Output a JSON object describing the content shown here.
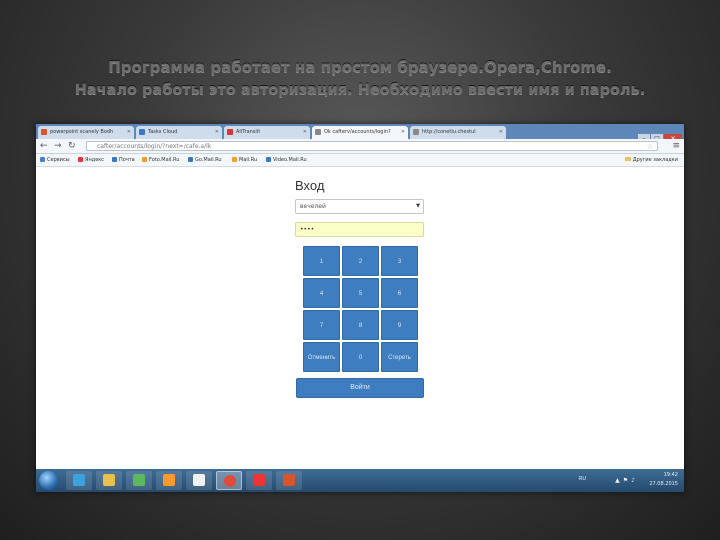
{
  "slide": {
    "title_line1": "Программа работает на простом браузере.Opera,Chrome.",
    "title_line2": "Начало работы это авторизация. Необходимо ввести имя и пароль."
  },
  "browser": {
    "tabs": [
      {
        "label": "powerpoint scanely Bodh",
        "color": "#d9532c"
      },
      {
        "label": "Tasks Cloud",
        "color": "#3b78c3"
      },
      {
        "label": "AllTranslit",
        "color": "#d33"
      },
      {
        "label": "Ok cafterv/accounts/login?",
        "color": "#888"
      },
      {
        "label": "http://conetlu.chestul",
        "color": "#888"
      }
    ],
    "window_buttons": {
      "min": "–",
      "max": "□",
      "close": "✕"
    },
    "url": "cafter/accounts/login/?next=/cafe.a/lk",
    "bookmarks": [
      {
        "label": "Сервисы",
        "color": "#4a7fd0"
      },
      {
        "label": "Яндекс",
        "color": "#e33"
      },
      {
        "label": "Почта",
        "color": "#3b78c3"
      },
      {
        "label": "Foto.Mail.Ru",
        "color": "#f0a030"
      },
      {
        "label": "Go.Mail.Ru",
        "color": "#3b78c3"
      },
      {
        "label": "Mail.Ru",
        "color": "#f0a030"
      },
      {
        "label": "Video.Mail.Ru",
        "color": "#3b78c3"
      }
    ],
    "other_bookmarks": "Другие закладки"
  },
  "login": {
    "title": "Вход",
    "user_selected": "вечелей",
    "password_value": "••••",
    "keys": [
      "1",
      "2",
      "3",
      "4",
      "5",
      "6",
      "7",
      "8",
      "9",
      "Отменить",
      "0",
      "Стереть"
    ],
    "submit_label": "Войти"
  },
  "taskbar": {
    "apps": [
      {
        "name": "ie",
        "color": "#3fa0e0"
      },
      {
        "name": "explorer",
        "color": "#e8c04a"
      },
      {
        "name": "app-green",
        "color": "#5cb85c"
      },
      {
        "name": "media",
        "color": "#ff9a2e"
      },
      {
        "name": "arrow",
        "color": "#f1f1f1"
      },
      {
        "name": "chrome",
        "color": "#e04b3a"
      },
      {
        "name": "yandex",
        "color": "#e33"
      },
      {
        "name": "paint",
        "color": "#d9532c"
      }
    ],
    "lang": "RU",
    "time": "19:42",
    "date": "27.08.2015"
  }
}
